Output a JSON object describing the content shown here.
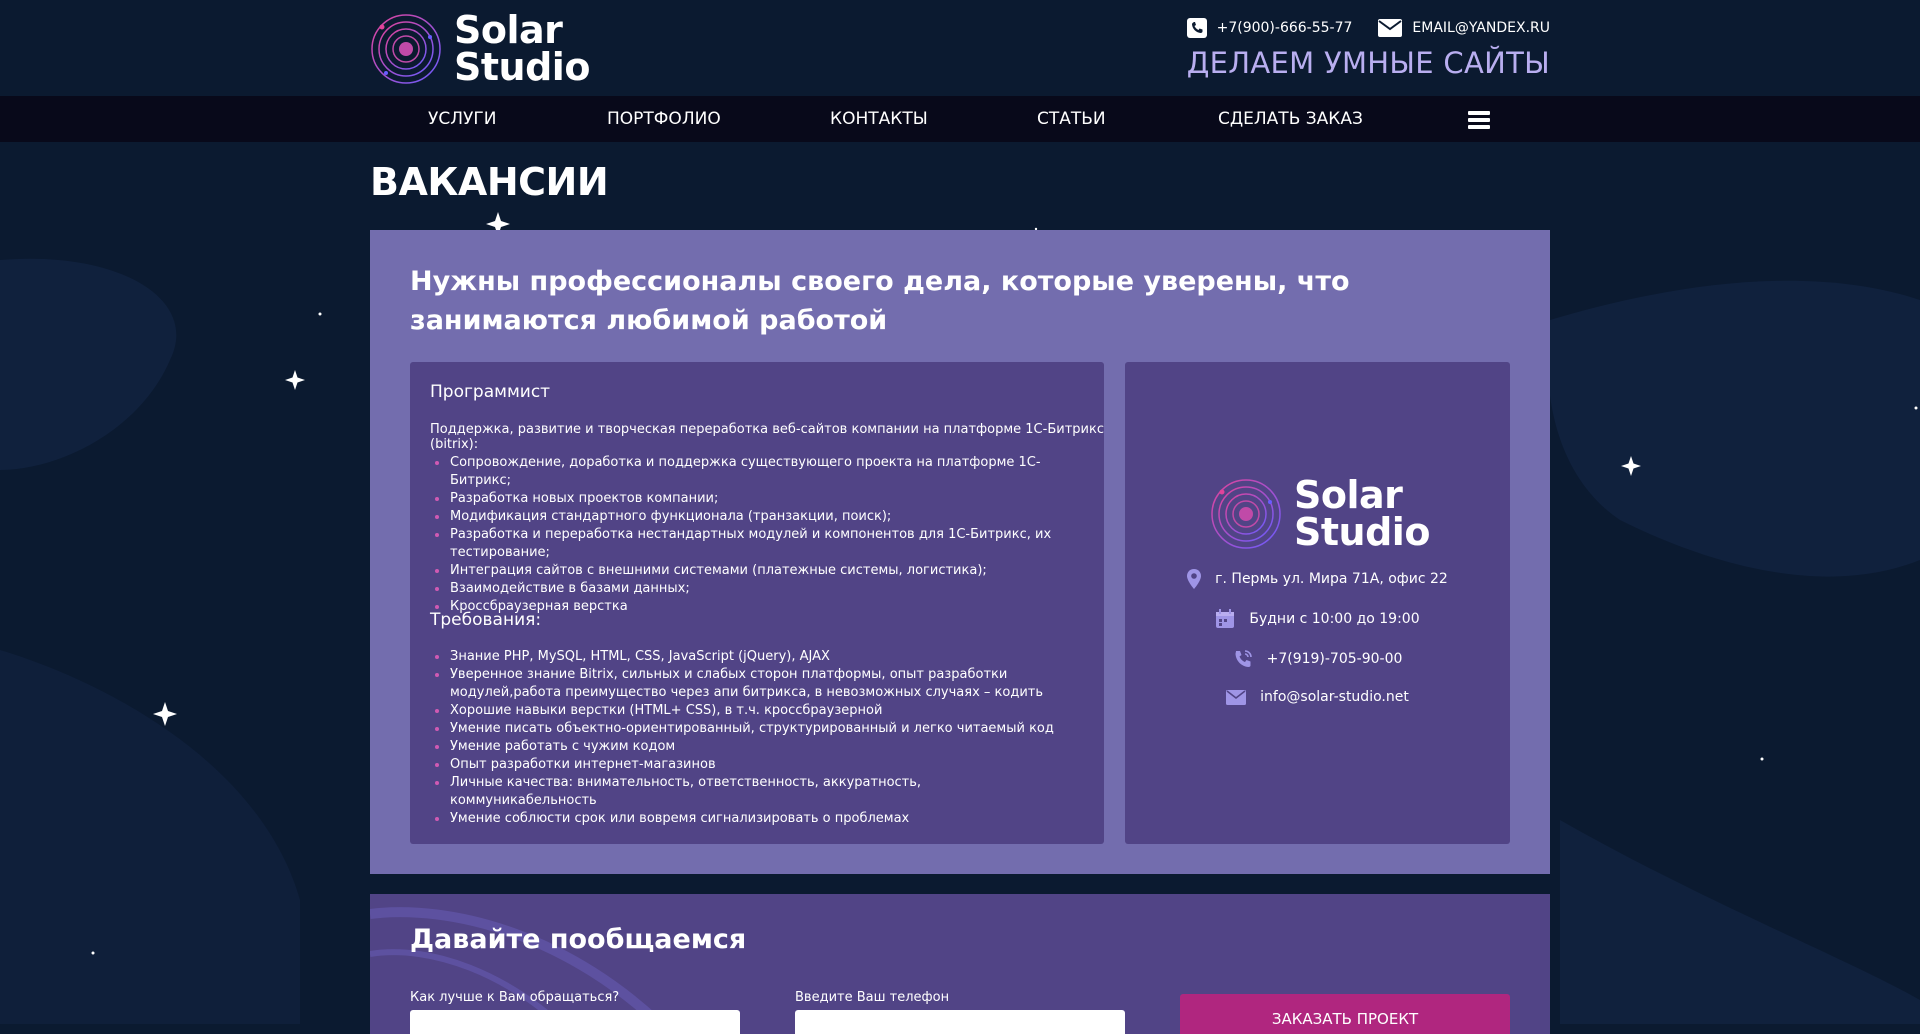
{
  "header": {
    "logo_line1": "Solar",
    "logo_line2": "Studio",
    "phone": "+7(900)-666-55-77",
    "email": "EMAIL@YANDEX.RU",
    "slogan": "ДЕЛАЕМ УМНЫЕ САЙТЫ"
  },
  "nav": {
    "items": [
      "УСЛУГИ",
      "ПОРТФОЛИО",
      "КОНТАКТЫ",
      "СТАТЬИ",
      "СДЕЛАТЬ ЗАКАЗ"
    ]
  },
  "page": {
    "title": "ВАКАНСИИ",
    "heading": "Нужны профессионалы своего дела, которые уверены, что занимаются любимой работой"
  },
  "job": {
    "title": "Программист",
    "intro": "Поддержка, развитие и творческая переработка веб-сайтов компании на платформе 1С-Битрикс (bitrix):",
    "duties": [
      "Сопровождение, доработка и поддержка существующего проекта на платформе 1С-Битрикс;",
      "Разработка новых проектов компании;",
      "Модификация стандартного функционала (транзакции, поиск);",
      "Разработка и переработка нестандартных модулей и компонентов для 1С-Битрикс, их тестирование;",
      "Интеграция сайтов с внешними системами (платежные системы, логистика);",
      "Взаимодействие в базами данных;",
      "Кроссбраузерная верстка"
    ],
    "requirements_title": "Требования:",
    "requirements": [
      "Знание PHP, MySQL, HTML, CSS, JavaScript (jQuery), AJAX",
      "Уверенное знание Bitrix, сильных и слабых сторон платформы, опыт разработки модулей,работа преимущество через апи битрикса, в невозможных случаях – кодить",
      "Хорошие навыки верстки (HTML+ CSS), в т.ч. кроссбраузерной",
      "Умение писать объектно-ориентированный, структурированный и легко читаемый код",
      "Умение работать с чужим кодом",
      "Опыт разработки интернет-магазинов",
      "Личные качества: внимательность, ответственность, аккуратность, коммуникабельность",
      "Умение соблюсти срок или вовремя сигнализировать о проблемах"
    ]
  },
  "card": {
    "logo_line1": "Solar",
    "logo_line2": "Studio",
    "address": "г. Пермь ул. Мира 71А, офис 22",
    "hours": "Будни с 10:00 до 19:00",
    "phone": "+7(919)-705-90-00",
    "email": "info@solar-studio.net"
  },
  "form": {
    "title": "Давайте пообщаемся",
    "name_label": "Как лучше к Вам обращаться?",
    "phone_label": "Введите Ваш телефон",
    "submit": "ЗАКАЗАТЬ ПРОЕКТ"
  },
  "colors": {
    "background": "#0b1a30",
    "nav": "#08091a",
    "panel": "#736dae",
    "card": "#514486",
    "accent": "#b0267f",
    "bullet": "#d05ab3",
    "slogan": "#b9aef0"
  }
}
